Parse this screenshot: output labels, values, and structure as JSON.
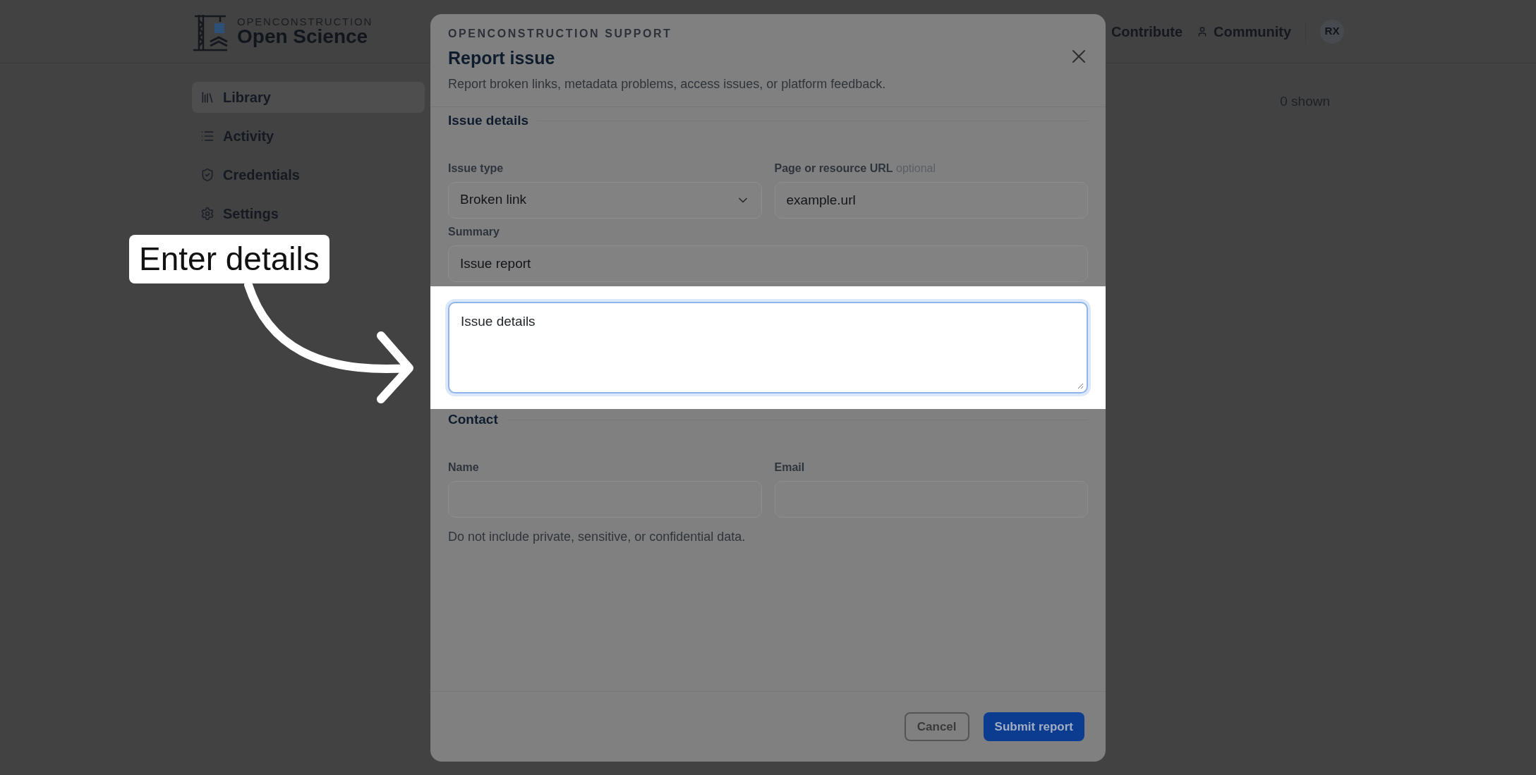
{
  "header": {
    "brand_top": "OPENCONSTRUCTION",
    "brand": "Open Science",
    "nav": [
      {
        "label": "Contribute"
      },
      {
        "label": "Community"
      }
    ],
    "avatar": "RX"
  },
  "sidebar": {
    "items": [
      {
        "label": "Library",
        "selected": true
      },
      {
        "label": "Activity",
        "selected": false
      },
      {
        "label": "Credentials",
        "selected": false
      },
      {
        "label": "Settings",
        "selected": false
      }
    ]
  },
  "results": {
    "count": "0 shown"
  },
  "dialog": {
    "eyebrow": "OPENCONSTRUCTION SUPPORT",
    "title": "Report issue",
    "description": "Report broken links, metadata problems, access issues, or platform feedback.",
    "sections": [
      {
        "heading": "Issue details",
        "rows": [
          {
            "highlighted": false,
            "fields": [
              {
                "kind": "select",
                "label": "Issue type",
                "value": "Broken link"
              },
              {
                "kind": "text",
                "label": "Page or resource URL",
                "hint": "optional",
                "value": "example.url"
              }
            ]
          },
          {
            "highlighted": false,
            "fields": [
              {
                "kind": "text",
                "label": "Summary",
                "value": "Issue report"
              }
            ]
          },
          {
            "highlighted": true,
            "fields": [
              {
                "kind": "textarea",
                "value": "Issue details"
              }
            ]
          }
        ]
      },
      {
        "heading": "Contact",
        "rows": [
          {
            "highlighted": false,
            "fields": [
              {
                "kind": "text",
                "label": "Name"
              },
              {
                "kind": "text",
                "label": "Email"
              }
            ]
          }
        ],
        "note": "Do not include private, sensitive, or confidential data."
      }
    ],
    "buttons": [
      {
        "label": "Cancel",
        "kind": "secondary"
      },
      {
        "label": "Submit report",
        "kind": "primary"
      }
    ]
  },
  "callout": {
    "text": "Enter details"
  }
}
